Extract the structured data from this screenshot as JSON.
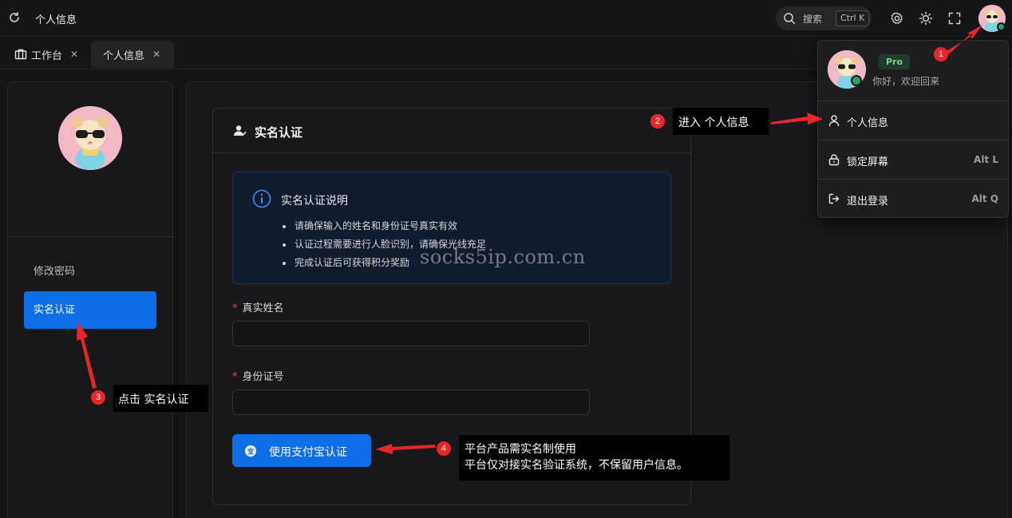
{
  "header": {
    "title": "个人信息",
    "search_label": "搜索",
    "search_shortcut": "Ctrl K"
  },
  "tabs": [
    {
      "label": "工作台"
    },
    {
      "label": "个人信息"
    }
  ],
  "sidebar": {
    "items": [
      {
        "label": "修改密码"
      },
      {
        "label": "实名认证"
      }
    ]
  },
  "card": {
    "title": "实名认证",
    "notice_title": "实名认证说明",
    "notice_items": [
      "请确保输入的姓名和身份证号真实有效",
      "认证过程需要进行人脸识别，请确保光线充足",
      "完成认证后可获得积分奖励"
    ],
    "name_label": "真实姓名",
    "name_value": "",
    "id_label": "身份证号",
    "id_value": "",
    "submit_label": "使用支付宝认证",
    "required_mark": "*"
  },
  "watermark": "socks5ip.com.cn",
  "dropdown": {
    "badge": "Pro",
    "greeting": "你好，欢迎回来",
    "items": [
      {
        "label": "个人信息",
        "shortcut": ""
      },
      {
        "label": "锁定屏幕",
        "shortcut": "Alt L"
      },
      {
        "label": "退出登录",
        "shortcut": "Alt Q"
      }
    ]
  },
  "annotations": {
    "step1": "1",
    "step2": "2",
    "step2_text": "进入 个人信息",
    "step3": "3",
    "step3_text": "点击 实名认证",
    "step4": "4",
    "step4_line1": "平台产品需实名制使用",
    "step4_line2": "平台仅对接实名验证系统，不保留用户信息。"
  },
  "colors": {
    "accent": "#0e6ee8",
    "annotation_red": "#e8262a",
    "pro_badge": "#6ed68c"
  }
}
